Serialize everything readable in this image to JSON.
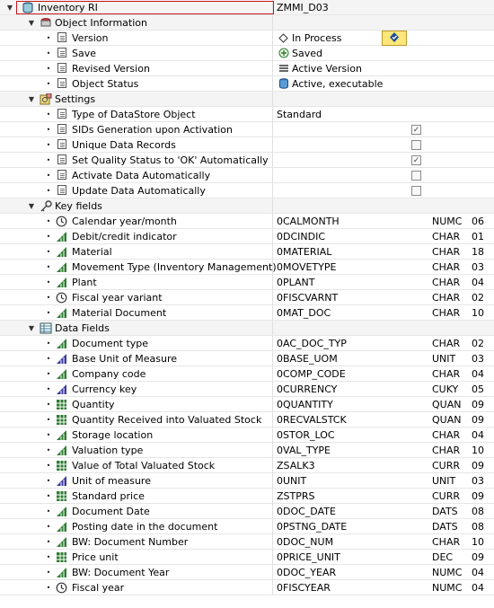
{
  "root": {
    "label": "Inventory RI",
    "value": "ZMMI_D03"
  },
  "object_information": {
    "label": "Object Information",
    "items": [
      {
        "label": "Version",
        "value": "In Process",
        "value_icon": "diamond-icon"
      },
      {
        "label": "Save",
        "value": "Saved",
        "value_icon": "save-plus-icon"
      },
      {
        "label": "Revised Version",
        "value": "Active Version",
        "value_icon": "lines-icon"
      },
      {
        "label": "Object Status",
        "value": "Active, executable",
        "value_icon": "database-icon"
      }
    ],
    "status_button_icon": "activate-icon"
  },
  "settings": {
    "label": "Settings",
    "items": [
      {
        "label": "Type of DataStore Object",
        "value": "Standard"
      },
      {
        "label": "SIDs Generation upon Activation",
        "checked": true
      },
      {
        "label": "Unique Data Records",
        "checked": false
      },
      {
        "label": "Set Quality Status to 'OK' Automatically",
        "checked": true
      },
      {
        "label": "Activate Data Automatically",
        "checked": false
      },
      {
        "label": "Update Data Automatically",
        "checked": false
      }
    ]
  },
  "key_fields": {
    "label": "Key fields",
    "items": [
      {
        "label": "Calendar year/month",
        "name": "0CALMONTH",
        "type": "NUMC",
        "length": "06",
        "icon": "clock-icon"
      },
      {
        "label": "Debit/credit indicator",
        "name": "0DCINDIC",
        "type": "CHAR",
        "length": "01",
        "icon": "characteristic-icon"
      },
      {
        "label": "Material",
        "name": "0MATERIAL",
        "type": "CHAR",
        "length": "18",
        "icon": "characteristic-icon"
      },
      {
        "label": "Movement Type (Inventory Management)",
        "name": "0MOVETYPE",
        "type": "CHAR",
        "length": "03",
        "icon": "characteristic-icon"
      },
      {
        "label": "Plant",
        "name": "0PLANT",
        "type": "CHAR",
        "length": "04",
        "icon": "characteristic-icon"
      },
      {
        "label": "Fiscal year variant",
        "name": "0FISCVARNT",
        "type": "CHAR",
        "length": "02",
        "icon": "clock-icon"
      },
      {
        "label": "Material Document",
        "name": "0MAT_DOC",
        "type": "CHAR",
        "length": "10",
        "icon": "characteristic-icon"
      }
    ]
  },
  "data_fields": {
    "label": "Data Fields",
    "items": [
      {
        "label": "Document type",
        "name": "0AC_DOC_TYP",
        "type": "CHAR",
        "length": "02",
        "icon": "characteristic-icon"
      },
      {
        "label": "Base Unit of Measure",
        "name": "0BASE_UOM",
        "type": "UNIT",
        "length": "03",
        "icon": "unit-icon"
      },
      {
        "label": "Company code",
        "name": "0COMP_CODE",
        "type": "CHAR",
        "length": "04",
        "icon": "characteristic-icon"
      },
      {
        "label": "Currency key",
        "name": "0CURRENCY",
        "type": "CUKY",
        "length": "05",
        "icon": "unit-icon"
      },
      {
        "label": "Quantity",
        "name": "0QUANTITY",
        "type": "QUAN",
        "length": "09",
        "icon": "keyfigure-icon"
      },
      {
        "label": "Quantity Received into Valuated Stock",
        "name": "0RECVALSTCK",
        "type": "QUAN",
        "length": "09",
        "icon": "keyfigure-icon"
      },
      {
        "label": "Storage location",
        "name": "0STOR_LOC",
        "type": "CHAR",
        "length": "04",
        "icon": "characteristic-icon"
      },
      {
        "label": "Valuation type",
        "name": "0VAL_TYPE",
        "type": "CHAR",
        "length": "10",
        "icon": "characteristic-icon"
      },
      {
        "label": "Value of Total Valuated Stock",
        "name": "ZSALK3",
        "type": "CURR",
        "length": "09",
        "icon": "keyfigure-icon"
      },
      {
        "label": "Unit of measure",
        "name": "0UNIT",
        "type": "UNIT",
        "length": "03",
        "icon": "unit-icon"
      },
      {
        "label": "Standard price",
        "name": "ZSTPRS",
        "type": "CURR",
        "length": "09",
        "icon": "keyfigure-icon"
      },
      {
        "label": "Document Date",
        "name": "0DOC_DATE",
        "type": "DATS",
        "length": "08",
        "icon": "characteristic-icon"
      },
      {
        "label": "Posting date in the document",
        "name": "0PSTNG_DATE",
        "type": "DATS",
        "length": "08",
        "icon": "characteristic-icon"
      },
      {
        "label": "BW: Document Number",
        "name": "0DOC_NUM",
        "type": "CHAR",
        "length": "10",
        "icon": "characteristic-icon"
      },
      {
        "label": "Price unit",
        "name": "0PRICE_UNIT",
        "type": "DEC",
        "length": "09",
        "icon": "keyfigure-icon"
      },
      {
        "label": "BW: Document Year",
        "name": "0DOC_YEAR",
        "type": "NUMC",
        "length": "04",
        "icon": "characteristic-icon"
      },
      {
        "label": "Fiscal year",
        "name": "0FISCYEAR",
        "type": "NUMC",
        "length": "04",
        "icon": "clock-icon"
      }
    ]
  },
  "colors": {
    "characteristic": "#2e7d32",
    "keyfigure": "#2e7d32",
    "unit": "#3a3aa0",
    "selection": "#c41a1a",
    "status_button": "#ffe67a"
  }
}
